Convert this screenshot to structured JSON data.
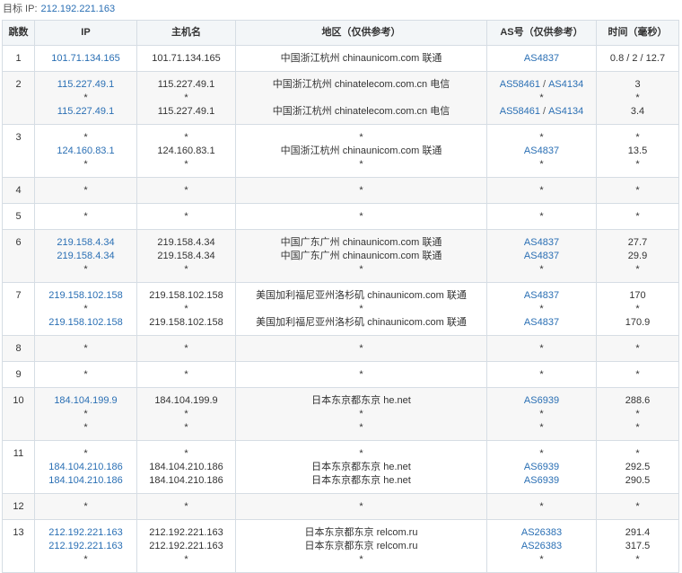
{
  "target": {
    "label": "目标 IP:",
    "ip": "212.192.221.163"
  },
  "headers": [
    "跳数",
    "IP",
    "主机名",
    "地区（仅供参考）",
    "AS号（仅供参考）",
    "时间（毫秒）"
  ],
  "hops": [
    {
      "hop": "1",
      "lines": [
        {
          "ip": "101.71.134.165",
          "host": "101.71.134.165",
          "loc": "中国浙江杭州 chinaunicom.com 联通",
          "as": [
            "AS4837"
          ],
          "time": "0.8 / 2 / 12.7"
        }
      ]
    },
    {
      "hop": "2",
      "lines": [
        {
          "ip": "115.227.49.1",
          "host": "115.227.49.1",
          "loc": "中国浙江杭州 chinatelecom.com.cn 电信",
          "as": [
            "AS58461",
            "AS4134"
          ],
          "time": "3"
        },
        {
          "ip": "*",
          "host": "*",
          "loc": "",
          "as": [
            "*"
          ],
          "time": "*"
        },
        {
          "ip": "115.227.49.1",
          "host": "115.227.49.1",
          "loc": "中国浙江杭州 chinatelecom.com.cn 电信",
          "as": [
            "AS58461",
            "AS4134"
          ],
          "time": "3.4"
        }
      ]
    },
    {
      "hop": "3",
      "lines": [
        {
          "ip": "*",
          "host": "*",
          "loc": "*",
          "as": [
            "*"
          ],
          "time": "*"
        },
        {
          "ip": "124.160.83.1",
          "host": "124.160.83.1",
          "loc": "中国浙江杭州 chinaunicom.com 联通",
          "as": [
            "AS4837"
          ],
          "time": "13.5"
        },
        {
          "ip": "*",
          "host": "*",
          "loc": "*",
          "as": [
            "*"
          ],
          "time": "*"
        }
      ]
    },
    {
      "hop": "4",
      "lines": [
        {
          "ip": "*",
          "host": "*",
          "loc": "*",
          "as": [
            "*"
          ],
          "time": "*"
        }
      ]
    },
    {
      "hop": "5",
      "lines": [
        {
          "ip": "*",
          "host": "*",
          "loc": "*",
          "as": [
            "*"
          ],
          "time": "*"
        }
      ]
    },
    {
      "hop": "6",
      "lines": [
        {
          "ip": "219.158.4.34",
          "host": "219.158.4.34",
          "loc": "中国广东广州 chinaunicom.com 联通",
          "as": [
            "AS4837"
          ],
          "time": "27.7"
        },
        {
          "ip": "219.158.4.34",
          "host": "219.158.4.34",
          "loc": "中国广东广州 chinaunicom.com 联通",
          "as": [
            "AS4837"
          ],
          "time": "29.9"
        },
        {
          "ip": "*",
          "host": "*",
          "loc": "*",
          "as": [
            "*"
          ],
          "time": "*"
        }
      ]
    },
    {
      "hop": "7",
      "lines": [
        {
          "ip": "219.158.102.158",
          "host": "219.158.102.158",
          "loc": "美国加利福尼亚州洛杉矶 chinaunicom.com 联通",
          "as": [
            "AS4837"
          ],
          "time": "170"
        },
        {
          "ip": "*",
          "host": "*",
          "loc": "*",
          "as": [
            "*"
          ],
          "time": "*"
        },
        {
          "ip": "219.158.102.158",
          "host": "219.158.102.158",
          "loc": "美国加利福尼亚州洛杉矶 chinaunicom.com 联通",
          "as": [
            "AS4837"
          ],
          "time": "170.9"
        }
      ]
    },
    {
      "hop": "8",
      "lines": [
        {
          "ip": "*",
          "host": "*",
          "loc": "*",
          "as": [
            "*"
          ],
          "time": "*"
        }
      ]
    },
    {
      "hop": "9",
      "lines": [
        {
          "ip": "*",
          "host": "*",
          "loc": "*",
          "as": [
            "*"
          ],
          "time": "*"
        }
      ]
    },
    {
      "hop": "10",
      "lines": [
        {
          "ip": "184.104.199.9",
          "host": "184.104.199.9",
          "loc": "日本东京都东京 he.net",
          "as": [
            "AS6939"
          ],
          "time": "288.6"
        },
        {
          "ip": "*",
          "host": "*",
          "loc": "*",
          "as": [
            "*"
          ],
          "time": "*"
        },
        {
          "ip": "*",
          "host": "*",
          "loc": "*",
          "as": [
            "*"
          ],
          "time": "*"
        }
      ]
    },
    {
      "hop": "11",
      "lines": [
        {
          "ip": "*",
          "host": "*",
          "loc": "*",
          "as": [
            "*"
          ],
          "time": "*"
        },
        {
          "ip": "184.104.210.186",
          "host": "184.104.210.186",
          "loc": "日本东京都东京 he.net",
          "as": [
            "AS6939"
          ],
          "time": "292.5"
        },
        {
          "ip": "184.104.210.186",
          "host": "184.104.210.186",
          "loc": "日本东京都东京 he.net",
          "as": [
            "AS6939"
          ],
          "time": "290.5"
        }
      ]
    },
    {
      "hop": "12",
      "lines": [
        {
          "ip": "*",
          "host": "*",
          "loc": "*",
          "as": [
            "*"
          ],
          "time": "*"
        }
      ]
    },
    {
      "hop": "13",
      "lines": [
        {
          "ip": "212.192.221.163",
          "host": "212.192.221.163",
          "loc": "日本东京都东京 relcom.ru",
          "as": [
            "AS26383"
          ],
          "time": "291.4"
        },
        {
          "ip": "212.192.221.163",
          "host": "212.192.221.163",
          "loc": "日本东京都东京 relcom.ru",
          "as": [
            "AS26383"
          ],
          "time": "317.5"
        },
        {
          "ip": "*",
          "host": "*",
          "loc": "*",
          "as": [
            "*"
          ],
          "time": "*"
        }
      ]
    }
  ]
}
